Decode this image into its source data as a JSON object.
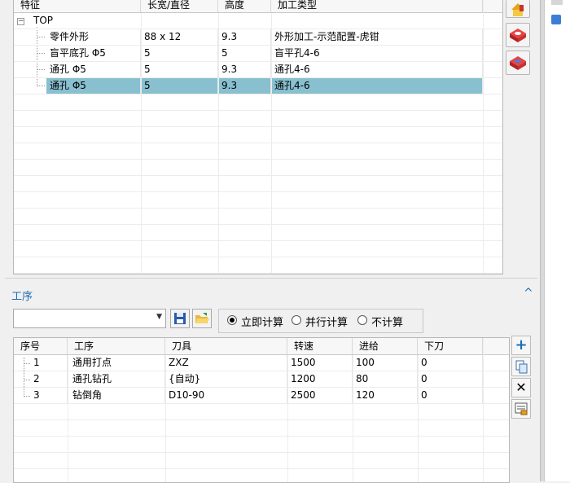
{
  "feature_table": {
    "columns": [
      "特征",
      "长宽/直径",
      "高度",
      "加工类型"
    ],
    "root": {
      "label": "TOP",
      "expander": "−"
    },
    "rows": [
      {
        "feature": "零件外形",
        "size": "88 x 12",
        "height": "9.3",
        "type": "外形加工-示范配置-虎钳"
      },
      {
        "feature": "盲平底孔 Φ5",
        "size": "5",
        "height": "5",
        "type": "盲平孔4-6"
      },
      {
        "feature": "通孔 Φ5",
        "size": "5",
        "height": "9.3",
        "type": "通孔4-6"
      },
      {
        "feature": "通孔 Φ5",
        "size": "5",
        "height": "9.3",
        "type": "通孔4-6",
        "selected": true
      }
    ]
  },
  "process": {
    "title": "工序",
    "collapse_icon": "^",
    "combo_value": "",
    "combo_arrow": "▼",
    "radios": [
      {
        "label": "立即计算",
        "checked": true
      },
      {
        "label": "并行计算",
        "checked": false
      },
      {
        "label": "不计算",
        "checked": false
      }
    ],
    "columns": [
      "序号",
      "工序",
      "刀具",
      "转速",
      "进给",
      "下刀"
    ],
    "rows": [
      {
        "no": "1",
        "op": "通用打点",
        "tool": "ZXZ",
        "speed": "1500",
        "feed": "100",
        "plunge": "0"
      },
      {
        "no": "2",
        "op": "通孔钻孔",
        "tool": "{自动}",
        "speed": "1200",
        "feed": "80",
        "plunge": "0"
      },
      {
        "no": "3",
        "op": "钻倒角",
        "tool": "D10-90",
        "speed": "2500",
        "feed": "120",
        "plunge": "0"
      }
    ],
    "buttons": {
      "add": "+",
      "delete": "✕"
    }
  },
  "colors": {
    "accent": "#1b6fb5",
    "selection": "#88c0d0"
  }
}
